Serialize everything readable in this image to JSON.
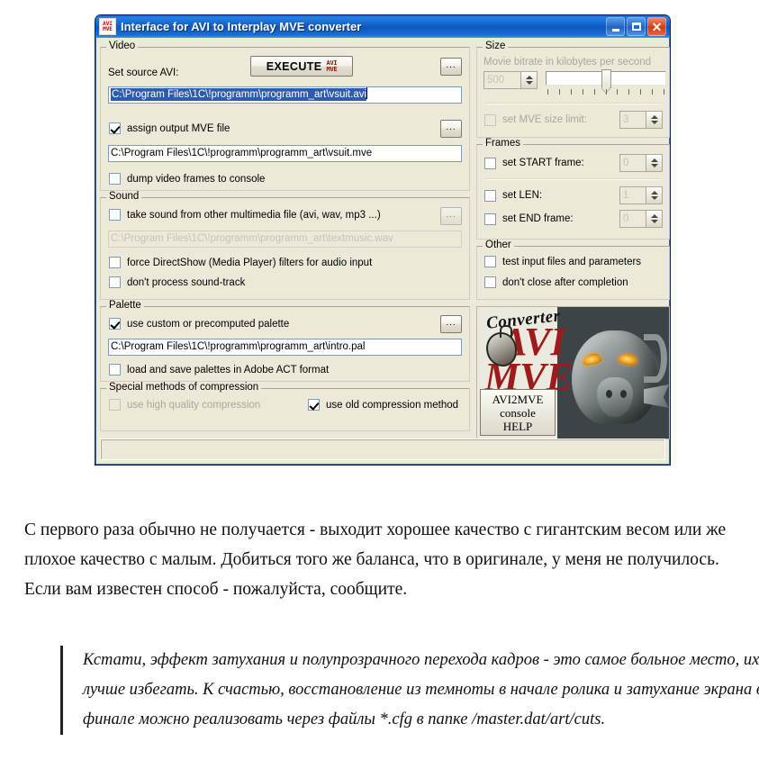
{
  "window": {
    "title": "Interface for AVI to Interplay MVE converter",
    "icon": "avimve-app-icon",
    "titlebar_color": "#1464cf",
    "buttons": {
      "minimize": "minimize",
      "maximize": "maximize",
      "close": "close"
    }
  },
  "video": {
    "group_title": "Video",
    "source_label": "Set source AVI:",
    "execute_label": "EXECUTE",
    "execute_icon_line1": "AVI",
    "execute_icon_line2": "MVE",
    "browse_label": "...",
    "source_value": "C:\\Program Files\\1C\\!programm\\programm_art\\vsuit.avi",
    "source_selected": true,
    "assign_output_label": "assign output MVE file",
    "assign_output_checked": true,
    "output_value": "C:\\Program Files\\1C\\!programm\\programm_art\\vsuit.mve",
    "dump_frames_label": "dump video frames to console",
    "dump_frames_checked": false
  },
  "sound": {
    "group_title": "Sound",
    "take_sound_label": "take sound from other multimedia file (avi, wav, mp3 ...)",
    "take_sound_checked": false,
    "browse_label": "...",
    "sound_file_value": "C:\\Program Files\\1C\\!programm\\programm_art\\textmusic.wav",
    "sound_file_disabled": true,
    "directshow_label": "force DirectShow (Media Player) filters for audio input",
    "directshow_checked": false,
    "no_soundtrack_label": "don't process sound-track",
    "no_soundtrack_checked": false
  },
  "palette": {
    "group_title": "Palette",
    "use_custom_label": "use custom or precomputed palette",
    "use_custom_checked": true,
    "browse_label": "...",
    "palette_value": "C:\\Program Files\\1C\\!programm\\programm_art\\intro.pal",
    "act_format_label": "load and save palettes in Adobe ACT format",
    "act_format_checked": false
  },
  "compression": {
    "group_title": "Special methods of compression",
    "high_quality_label": "use high quality compression",
    "high_quality_checked": false,
    "high_quality_disabled": true,
    "old_method_label": "use old compression method",
    "old_method_checked": true
  },
  "size": {
    "group_title": "Size",
    "bitrate_label": "Movie bitrate in kilobytes per second",
    "bitrate_value": "500",
    "bitrate_disabled": true,
    "slider_ticks": 11,
    "slider_position_percent": 50,
    "mve_limit_label": "set MVE size limit:",
    "mve_limit_checked": false,
    "mve_limit_value": "3",
    "mve_limit_disabled": true
  },
  "frames": {
    "group_title": "Frames",
    "start_label": "set START frame:",
    "start_checked": false,
    "start_value": "0",
    "len_label": "set LEN:",
    "len_checked": false,
    "len_value": "1",
    "end_label": "set END frame:",
    "end_checked": false,
    "end_value": "0"
  },
  "other": {
    "group_title": "Other",
    "test_input_label": "test input files and parameters",
    "test_input_checked": false,
    "dont_close_label": "don't close after completion",
    "dont_close_checked": false
  },
  "logo": {
    "converter_word": "Converter",
    "avi_word": "AVI",
    "mve_word": "MVE",
    "help_line1": "AVI2MVE",
    "help_line2": "console",
    "help_line3": "HELP",
    "brand_red": "#9e1b1b"
  },
  "article": {
    "paragraph": "С первого раза обычно не получается - выходит хорошее качество с гигантским весом или же плохое качество с малым. Добиться того же баланса, что в оригинале, у меня не получилось. Если вам известен способ - пожалуйста, сообщите.",
    "quote": "Кстати, эффект затухания и полупрозрачного перехода кадров - это самое больное место, их лучше избегать. К счастью, восстановление из темноты в начале ролика и затухание экрана в финале можно реализовать через файлы *.cfg в папке /master.dat/art/cuts."
  }
}
